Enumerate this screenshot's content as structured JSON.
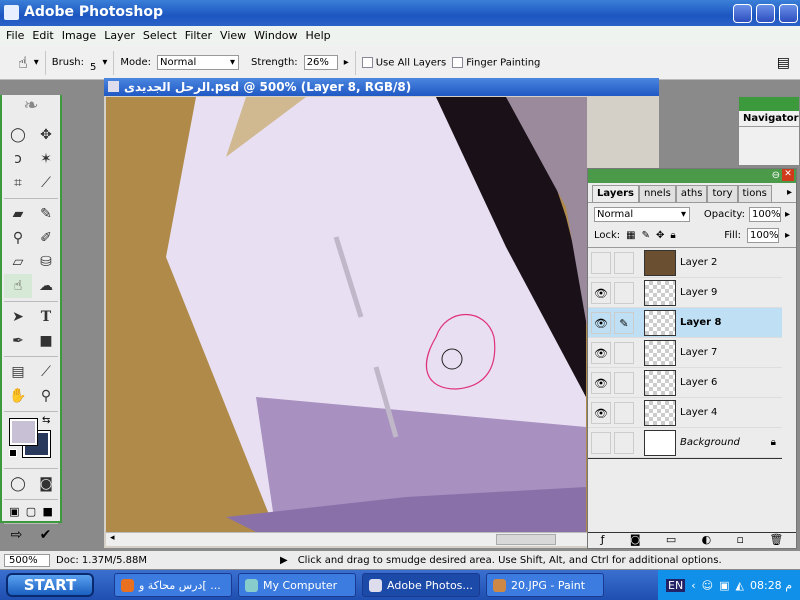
{
  "app": {
    "title": "Adobe Photoshop"
  },
  "menu": [
    "File",
    "Edit",
    "Image",
    "Layer",
    "Select",
    "Filter",
    "View",
    "Window",
    "Help"
  ],
  "options": {
    "brush_label": "Brush:",
    "brush_size": "5",
    "mode_label": "Mode:",
    "mode_value": "Normal",
    "strength_label": "Strength:",
    "strength_value": "26%",
    "use_all_layers": "Use All Layers",
    "finger_painting": "Finger Painting"
  },
  "document": {
    "title": "الرحل الجديدى.psd @ 500% (Layer 8, RGB/8)"
  },
  "navigator": {
    "tab": "Navigator"
  },
  "layers_panel": {
    "tabs": [
      "Layers",
      "nnels",
      "aths",
      "tory",
      "tions"
    ],
    "blend_mode": "Normal",
    "opacity_label": "Opacity:",
    "opacity": "100%",
    "lock_label": "Lock:",
    "fill_label": "Fill:",
    "fill": "100%",
    "layers": [
      {
        "name": "Layer 2",
        "visible": false
      },
      {
        "name": "Layer 9",
        "visible": true
      },
      {
        "name": "Layer 8",
        "visible": true,
        "selected": true
      },
      {
        "name": "Layer 7",
        "visible": true
      },
      {
        "name": "Layer 6",
        "visible": true
      },
      {
        "name": "Layer 4",
        "visible": true
      },
      {
        "name": "Background",
        "visible": false,
        "locked": true
      }
    ]
  },
  "status": {
    "zoom": "500%",
    "doc": "Doc: 1.37M/5.88M",
    "hint": "Click and drag to smudge desired area.  Use Shift, Alt, and Ctrl for additional options."
  },
  "taskbar": {
    "start": "START",
    "tasks": [
      "درس محاكة و[ ...",
      "My Computer",
      "Adobe Photos...",
      "20.JPG - Paint"
    ],
    "lang": "EN",
    "clock": "08:28 م"
  },
  "colors": {
    "foreground": "#c8c0d4",
    "background": "#2a3a5c",
    "accent": "#2058c4"
  }
}
